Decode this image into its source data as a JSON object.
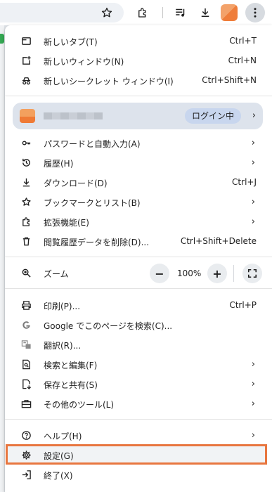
{
  "colors": {
    "highlight_border": "#e8763f",
    "profile_bg": "#dde3ec",
    "badge_bg": "#c8d6ee"
  },
  "toolbar": {
    "icons": [
      "star-icon",
      "extensions-icon",
      "reading-list-icon",
      "download-icon",
      "avatar",
      "more-vert-icon"
    ]
  },
  "menu": {
    "new_tab": {
      "label": "新しいタブ(T)",
      "shortcut": "Ctrl+T"
    },
    "new_window": {
      "label": "新しいウィンドウ(N)",
      "shortcut": "Ctrl+N"
    },
    "new_incognito": {
      "label": "新しいシークレット ウィンドウ(I)",
      "shortcut": "Ctrl+Shift+N"
    },
    "profile": {
      "status": "ログイン中"
    },
    "passwords": {
      "label": "パスワードと自動入力(A)"
    },
    "history": {
      "label": "履歴(H)"
    },
    "downloads": {
      "label": "ダウンロード(D)",
      "shortcut": "Ctrl+J"
    },
    "bookmarks": {
      "label": "ブックマークとリスト(B)"
    },
    "extensions": {
      "label": "拡張機能(E)"
    },
    "clear_data": {
      "label": "閲覧履歴データを削除(D)...",
      "shortcut": "Ctrl+Shift+Delete"
    },
    "zoom": {
      "label": "ズーム",
      "minus": "−",
      "value": "100%",
      "plus": "+"
    },
    "print": {
      "label": "印刷(P)...",
      "shortcut": "Ctrl+P"
    },
    "google_search": {
      "label": "Google でこのページを検索(C)..."
    },
    "translate": {
      "label": "翻訳(R)..."
    },
    "search_edit": {
      "label": "検索と編集(F)"
    },
    "save_share": {
      "label": "保存と共有(S)"
    },
    "more_tools": {
      "label": "その他のツール(L)"
    },
    "help": {
      "label": "ヘルプ(H)"
    },
    "settings": {
      "label": "設定(G)"
    },
    "exit": {
      "label": "終了(X)"
    },
    "chevron": "›"
  }
}
